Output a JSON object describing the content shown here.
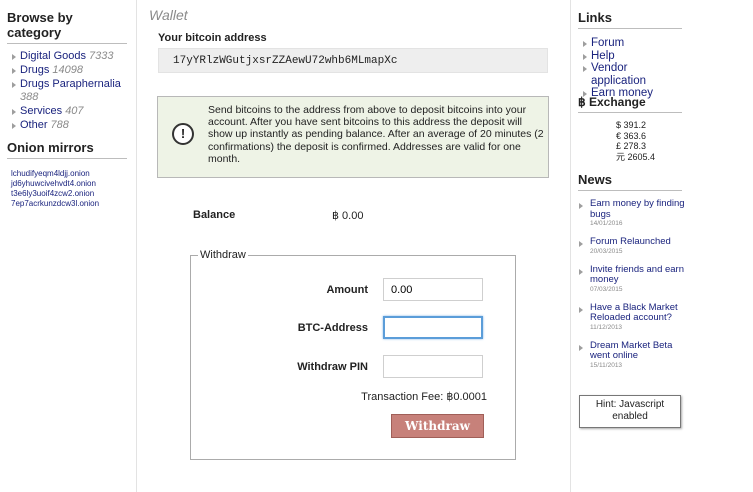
{
  "sidebar": {
    "category_title": "Browse by category",
    "categories": [
      {
        "label": "Digital Goods",
        "count": "7333"
      },
      {
        "label": "Drugs",
        "count": "14098"
      },
      {
        "label": "Drugs Paraphernalia",
        "count": "388"
      },
      {
        "label": "Services",
        "count": "407"
      },
      {
        "label": "Other",
        "count": "788"
      }
    ],
    "mirrors_title": "Onion mirrors",
    "mirrors": [
      "lchudifyeqm4ldjj.onion",
      "jd6yhuwcivehvdt4.onion",
      "t3e6ly3uoif4zcw2.onion",
      "7ep7acrkunzdcw3l.onion"
    ]
  },
  "main": {
    "title": "Wallet",
    "address_label": "Your bitcoin address",
    "address": "17yYRlzWGutjxsrZZAewU72whb6MLmapXc",
    "notice": "Send bitcoins to the address from above to deposit bitcoins into your account. After you have sent bitcoins to this address the deposit will show up instantly as pending balance. After an average of 20 minutes (2 confirmations) the deposit is confirmed. Addresses are valid for one month.",
    "balance_label": "Balance",
    "balance_value": "฿  0.00",
    "withdraw": {
      "legend": "Withdraw",
      "amount_label": "Amount",
      "amount_value": "0.00",
      "btc_label": "BTC-Address",
      "btc_value": "",
      "pin_label": "Withdraw PIN",
      "pin_value": "",
      "fee": "Transaction Fee: ฿0.0001",
      "button": "Withdraw"
    }
  },
  "right": {
    "links_title": "Links",
    "links": [
      "Forum",
      "Help",
      "Vendor application",
      "Earn money"
    ],
    "exchange_title": "฿ Exchange",
    "rates": [
      "$ 391.2",
      "€ 363.6",
      "£ 278.3",
      "元 2605.4"
    ],
    "news_title": "News",
    "news": [
      {
        "title": "Earn money by finding bugs",
        "date": "14/01/2016"
      },
      {
        "title": "Forum Relaunched",
        "date": "20/03/2015"
      },
      {
        "title": "Invite friends and earn money",
        "date": "07/03/2015"
      },
      {
        "title": "Have a Black Market Reloaded account?",
        "date": "11/12/2013"
      },
      {
        "title": "Dream Market Beta went online",
        "date": "15/11/2013"
      }
    ],
    "hint": "Hint: Javascript enabled"
  }
}
